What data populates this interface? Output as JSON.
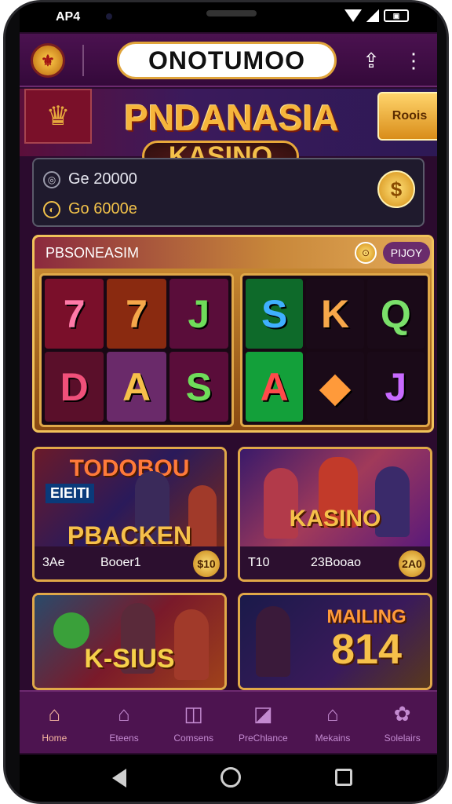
{
  "status_bar": {
    "time": "AP4",
    "battery": "▣"
  },
  "header": {
    "brand": "ONOTUMOO",
    "logo_glyph": "⚜",
    "share_glyph": "⇪",
    "more_glyph": "⋮"
  },
  "banner": {
    "title": "PNDANASIA",
    "subtitle": "KASINO",
    "button": "Roois",
    "emblem_glyph": "♛"
  },
  "balance": {
    "row1": {
      "icon": "◎",
      "value": "Ge 20000"
    },
    "row2": {
      "icon": "◐",
      "value": "Go 6000e"
    },
    "coin": "$"
  },
  "slot": {
    "title": "PBSONEASIM",
    "coin": "⊙",
    "play": "PIJOY",
    "left_reels": [
      {
        "symbol": "7",
        "color": "#ff7aa8",
        "bg": "#7a0f2a"
      },
      {
        "symbol": "7",
        "color": "#f6a84a",
        "bg": "#8a2a10"
      },
      {
        "symbol": "J",
        "color": "#6fdc5a",
        "bg": "#5a0d3a"
      },
      {
        "symbol": "D",
        "color": "#f0507a",
        "bg": "#5a0f2a"
      },
      {
        "symbol": "A",
        "color": "#f6c04a",
        "bg": "#6a2a6a"
      },
      {
        "symbol": "S",
        "color": "#6fdc5a",
        "bg": "#5a0d3a"
      }
    ],
    "right_reels": [
      {
        "symbol": "S",
        "color": "#3fb0ff",
        "bg": "#0e6a2a"
      },
      {
        "symbol": "K",
        "color": "#f6a84a",
        "bg": "#1a0a18"
      },
      {
        "symbol": "Q",
        "color": "#7ae06a",
        "bg": "#1a0a18"
      },
      {
        "symbol": "A",
        "color": "#ff4a4a",
        "bg": "#13a03a"
      },
      {
        "symbol": "◆",
        "color": "#ff9a3a",
        "bg": "#1a0a18"
      },
      {
        "symbol": "J",
        "color": "#c86aff",
        "bg": "#1a0a18"
      }
    ]
  },
  "cards": [
    {
      "title": "PBACKEN",
      "tag": "EIEITI",
      "top_text": "TODOBOU",
      "f1": "3Ae",
      "f2": "Booer1",
      "f3": "$10"
    },
    {
      "title": "KASINO",
      "tag": "",
      "top_text": "",
      "f1": "T10",
      "f2": "23Booao",
      "f3": "2A0"
    },
    {
      "title": "K-SIUS",
      "tag": "",
      "top_text": "",
      "f1": "",
      "f2": "",
      "f3": ""
    },
    {
      "title": "814",
      "tag": "",
      "top_text": "MAILING",
      "f1": "",
      "f2": "",
      "f3": ""
    }
  ],
  "nav": [
    {
      "label": "Home",
      "icon": "⌂"
    },
    {
      "label": "Eteens",
      "icon": "⌂"
    },
    {
      "label": "Comsens",
      "icon": "◫"
    },
    {
      "label": "PreChlance",
      "icon": "◪"
    },
    {
      "label": "Mekains",
      "icon": "⌂"
    },
    {
      "label": "Solelairs",
      "icon": "✿"
    }
  ],
  "colors": {
    "accent_gold": "#f6b53b",
    "bg_purple": "#2b0b2e",
    "nav_purple": "#4d1450"
  }
}
